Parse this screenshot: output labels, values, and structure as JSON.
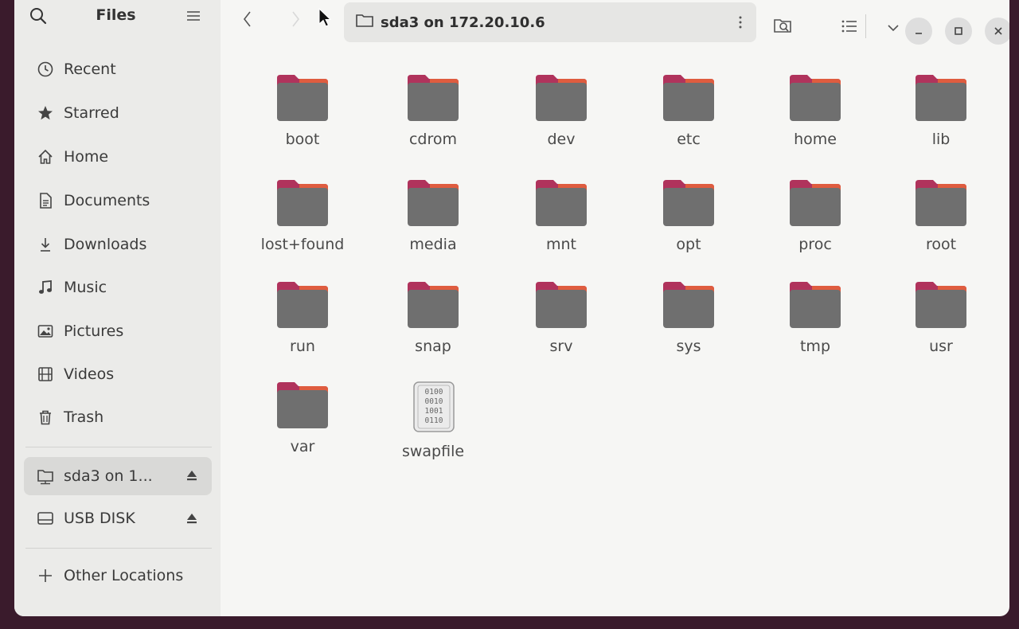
{
  "sidebar": {
    "title": "Files",
    "places": [
      {
        "label": "Recent",
        "icon": "clock-icon"
      },
      {
        "label": "Starred",
        "icon": "star-icon"
      },
      {
        "label": "Home",
        "icon": "home-icon"
      },
      {
        "label": "Documents",
        "icon": "document-icon"
      },
      {
        "label": "Downloads",
        "icon": "download-icon"
      },
      {
        "label": "Music",
        "icon": "music-note-icon"
      },
      {
        "label": "Pictures",
        "icon": "picture-icon"
      },
      {
        "label": "Videos",
        "icon": "film-icon"
      },
      {
        "label": "Trash",
        "icon": "trash-icon"
      }
    ],
    "devices": [
      {
        "label": "sda3 on 1...",
        "icon": "network-drive-icon",
        "eject": true,
        "active": true
      },
      {
        "label": "USB DISK",
        "icon": "disk-icon",
        "eject": true,
        "active": false
      }
    ],
    "other_locations": "Other Locations"
  },
  "header": {
    "path": "sda3 on 172.20.10.6"
  },
  "files": [
    {
      "name": "boot",
      "type": "folder"
    },
    {
      "name": "cdrom",
      "type": "folder"
    },
    {
      "name": "dev",
      "type": "folder"
    },
    {
      "name": "etc",
      "type": "folder"
    },
    {
      "name": "home",
      "type": "folder"
    },
    {
      "name": "lib",
      "type": "folder"
    },
    {
      "name": "lost+found",
      "type": "folder"
    },
    {
      "name": "media",
      "type": "folder"
    },
    {
      "name": "mnt",
      "type": "folder"
    },
    {
      "name": "opt",
      "type": "folder"
    },
    {
      "name": "proc",
      "type": "folder"
    },
    {
      "name": "root",
      "type": "folder"
    },
    {
      "name": "run",
      "type": "folder"
    },
    {
      "name": "snap",
      "type": "folder"
    },
    {
      "name": "srv",
      "type": "folder"
    },
    {
      "name": "sys",
      "type": "folder"
    },
    {
      "name": "tmp",
      "type": "folder"
    },
    {
      "name": "usr",
      "type": "folder"
    },
    {
      "name": "var",
      "type": "folder"
    },
    {
      "name": "swapfile",
      "type": "binary",
      "binary_text": [
        "0100",
        "0010",
        "1001",
        "0110"
      ]
    }
  ],
  "colors": {
    "folder_body": "#6f6f6f",
    "folder_tab": "#b0335c",
    "folder_accent": "#e8643a"
  }
}
